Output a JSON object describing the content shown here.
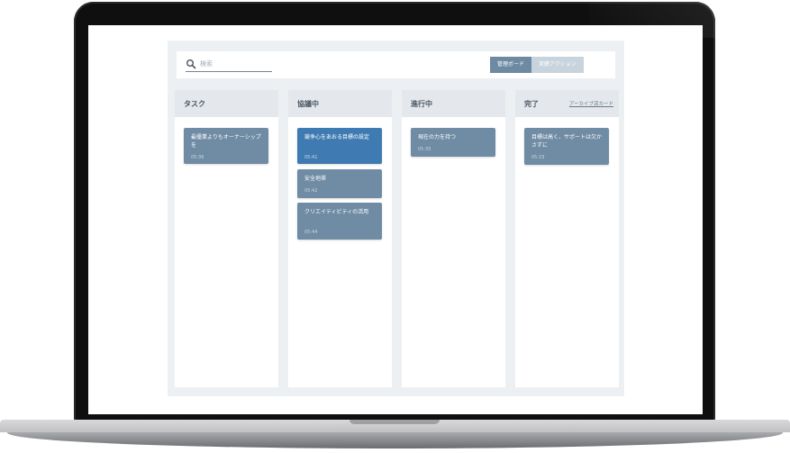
{
  "toolbar": {
    "search_placeholder": "検索",
    "view_toggle": [
      {
        "label": "管理ボード",
        "active": true
      },
      {
        "label": "実績アクション",
        "active": false
      }
    ]
  },
  "columns": [
    {
      "title": "タスク",
      "cards": [
        {
          "title": "最優業よりもオーナーシップを",
          "time": "05:36"
        }
      ]
    },
    {
      "title": "協議中",
      "cards": [
        {
          "title": "競争心をあおる目標の設定",
          "time": "05:41",
          "highlight": true
        },
        {
          "title": "安全地帯",
          "time": "05:42"
        },
        {
          "title": "クリエイティビティの活用",
          "time": "05:44"
        }
      ]
    },
    {
      "title": "進行中",
      "cards": [
        {
          "title": "現在の力を持つ",
          "time": "05:35"
        }
      ]
    },
    {
      "title": "完了",
      "archive_link": "アーカイブ済カード",
      "cards": [
        {
          "title": "目標は高く、サポートは欠かさずに",
          "time": "05:33"
        }
      ]
    }
  ],
  "colors": {
    "accent": "#6e8aa2",
    "card": "#6f8ca4",
    "card_highlight": "#3f7bb2",
    "background": "#edf0f3"
  }
}
